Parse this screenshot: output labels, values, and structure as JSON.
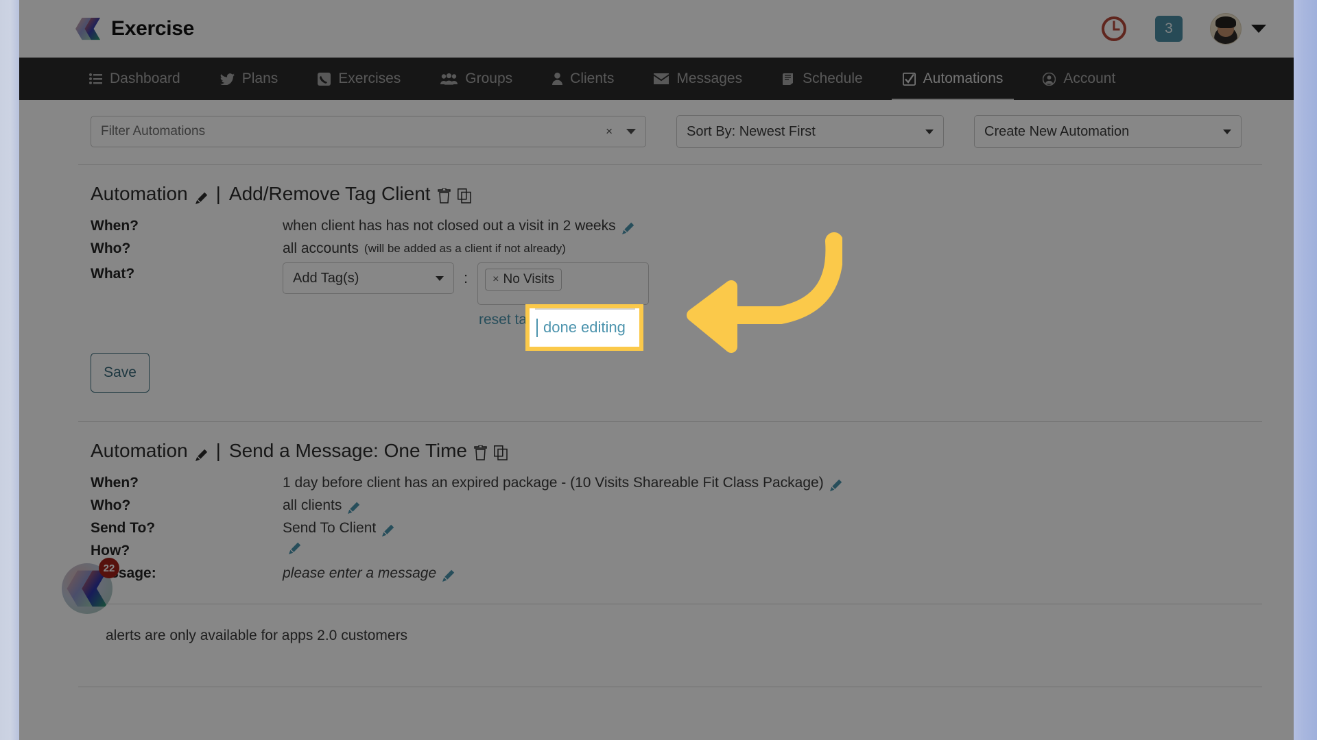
{
  "header": {
    "brand": "Exercise",
    "logo_icon": "exercise-chevron-logo",
    "clock_icon": "clock-icon",
    "notification_count": "3",
    "avatar_icon": "user-avatar",
    "chevron_icon": "chevron-down-icon"
  },
  "nav": {
    "items": [
      {
        "label": "Dashboard",
        "icon": "list-icon",
        "active": false
      },
      {
        "label": "Plans",
        "icon": "bird-icon",
        "active": false
      },
      {
        "label": "Exercises",
        "icon": "phone-icon",
        "active": false
      },
      {
        "label": "Groups",
        "icon": "users-icon",
        "active": false
      },
      {
        "label": "Clients",
        "icon": "person-icon",
        "active": false
      },
      {
        "label": "Messages",
        "icon": "envelope-icon",
        "active": false
      },
      {
        "label": "Schedule",
        "icon": "book-icon",
        "active": false
      },
      {
        "label": "Automations",
        "icon": "check-box-icon",
        "active": true
      },
      {
        "label": "Account",
        "icon": "user-circle-icon",
        "active": false
      }
    ]
  },
  "toolbar": {
    "filter_placeholder": "Filter Automations",
    "filter_clear_icon": "clear-x-icon",
    "filter_caret_icon": "chevron-down-icon",
    "sort_by": "Sort By: Newest First",
    "create_new": "Create New Automation"
  },
  "automations": [
    {
      "prefix": "Automation",
      "edit_icon": "pencil-icon",
      "separator": "|",
      "name": "Add/Remove Tag Client",
      "delete_icon": "trash-icon",
      "copy_icon": "copy-icon",
      "rows": [
        {
          "label": "When?",
          "value": "when client has has not closed out a visit in 2 weeks",
          "edit_icon": "pencil-icon"
        },
        {
          "label": "Who?",
          "value": "all accounts",
          "note": "(will be added as a client if not already)"
        },
        {
          "label": "What?",
          "value": ""
        }
      ],
      "what": {
        "tag_action": "Add Tag(s)",
        "tag_action_caret": "chevron-down-icon",
        "colon": ":",
        "tags": [
          {
            "remove_icon": "x-icon",
            "label": "No Visits"
          }
        ],
        "reset_link": "reset tags",
        "divider": "|",
        "done_link": "done editing"
      },
      "save_label": "Save"
    },
    {
      "prefix": "Automation",
      "edit_icon": "pencil-icon",
      "separator": "|",
      "name": "Send a Message: One Time",
      "delete_icon": "trash-icon",
      "copy_icon": "copy-icon",
      "rows": [
        {
          "label": "When?",
          "value": "1 day before client has an expired package - (10 Visits Shareable Fit Class Package)",
          "edit_icon": "pencil-icon"
        },
        {
          "label": "Who?",
          "value": "all clients",
          "edit_icon": "pencil-icon"
        },
        {
          "label": "Send To?",
          "value": "Send To Client",
          "edit_icon": "pencil-icon"
        },
        {
          "label": "How?",
          "value": "",
          "edit_icon": "pencil-icon"
        },
        {
          "label": "Message:",
          "value": "please enter a message",
          "edit_icon": "pencil-icon",
          "italic": true
        }
      ]
    }
  ],
  "footer": {
    "note": "alerts are only available for apps 2.0 customers",
    "widget_badge": "22",
    "widget_icon": "exercise-chevron-logo"
  },
  "callout": {
    "text": "done editing",
    "cursor": "text-cursor",
    "highlight_color": "#fbc94a",
    "arrow_icon": "curved-arrow-left"
  },
  "colors": {
    "nav_bg": "#2b2b2b",
    "link": "#4b93ad",
    "badge": "#4a8ca3",
    "highlight": "#fbc94a",
    "alert_badge": "#a3211a"
  }
}
